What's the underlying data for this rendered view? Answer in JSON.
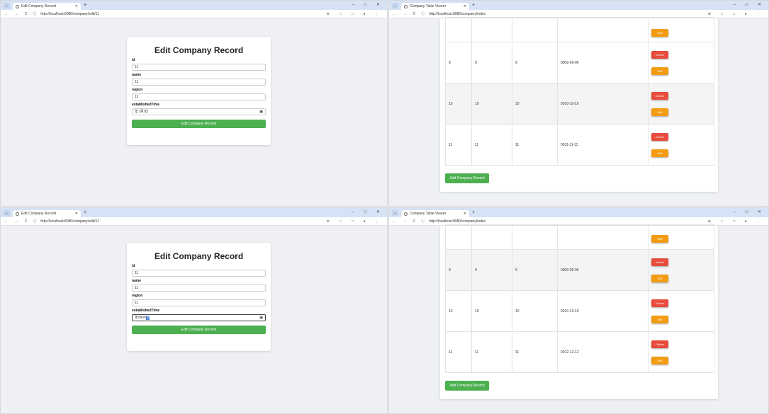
{
  "edit_window": {
    "tab_title": "Edit Company Record",
    "url": "http://localhost:8080/company/edit/11",
    "heading": "Edit Company Record",
    "fields": [
      {
        "label": "id",
        "value": "11"
      },
      {
        "label": "name",
        "value": "11"
      },
      {
        "label": "region",
        "value": "11"
      },
      {
        "label": "establishedTime",
        "value": ""
      }
    ],
    "date_value_top": "年 /月/日",
    "date_value_bottom_prefix": "年/06/0",
    "date_value_bottom_highlight": "日",
    "submit_label": "Edit Company Record"
  },
  "table_window": {
    "tab_title": "Company Table Viewer",
    "url": "http://localhost:8080/company/index",
    "top_rows": [
      {
        "id": "9",
        "name": "9",
        "region": "9",
        "established": "0009-09-09"
      },
      {
        "id": "10",
        "name": "10",
        "region": "10",
        "established": "0010-10-10"
      },
      {
        "id": "11",
        "name": "11",
        "region": "11",
        "established": "0011-11-11"
      }
    ],
    "bottom_rows": [
      {
        "id": "9",
        "name": "9",
        "region": "9",
        "established": "0009-09-09"
      },
      {
        "id": "10",
        "name": "10",
        "region": "10",
        "established": "0010-10-10"
      },
      {
        "id": "11",
        "name": "11",
        "region": "11",
        "established": "0012-12-12"
      }
    ],
    "delete_label": "Delete",
    "edit_label": "Edit",
    "add_label": "Add Company Record"
  },
  "window_controls": "– □ ✕",
  "nav_icons": "← → C",
  "tool_icons": "⊕ ☆ □ ● ⋮",
  "info_icon": "ⓘ",
  "new_tab": "+",
  "tab_close": "✕",
  "tab_menu": "⌄",
  "calendar_icon": "▣"
}
